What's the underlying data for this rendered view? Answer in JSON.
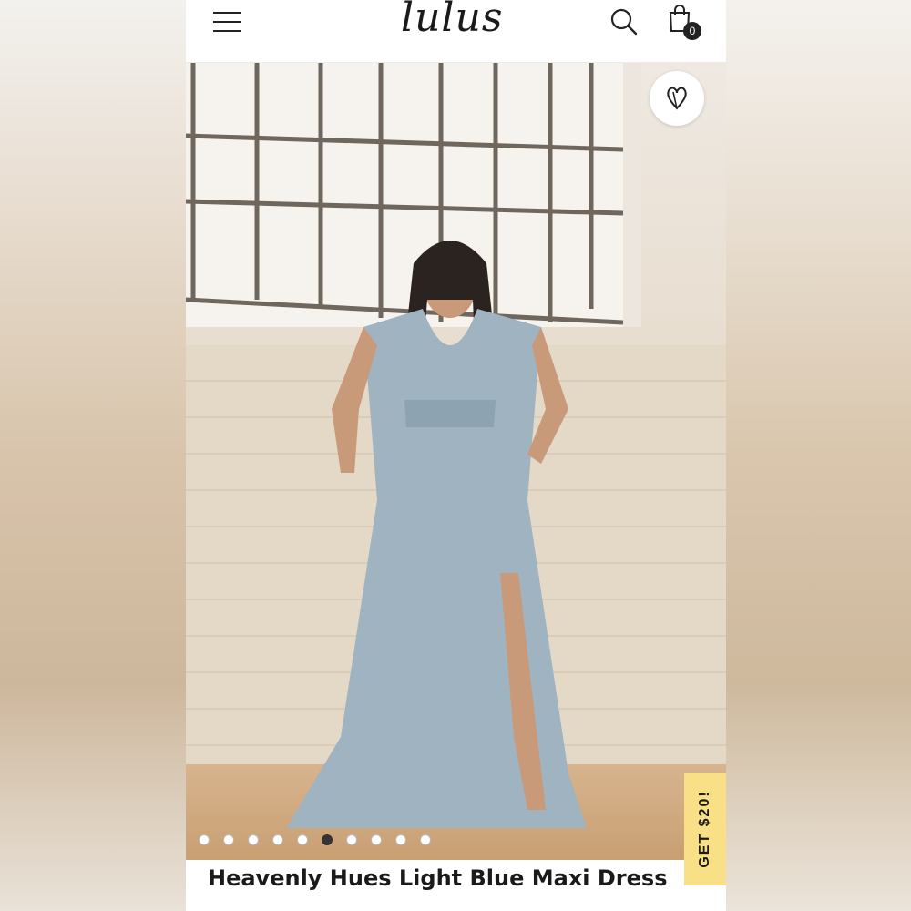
{
  "header": {
    "logo_text": "lulus",
    "cart_count": "0",
    "icons": [
      "hamburger-menu-icon",
      "search-icon",
      "shopping-bag-icon"
    ]
  },
  "gallery": {
    "image_count": 10,
    "active_index": 5,
    "favorite_icon": "heart-icon"
  },
  "promo": {
    "label": "GET $20!",
    "color": "#f9df86"
  },
  "product": {
    "title": "Heavenly Hues Light Blue Maxi Dress"
  }
}
